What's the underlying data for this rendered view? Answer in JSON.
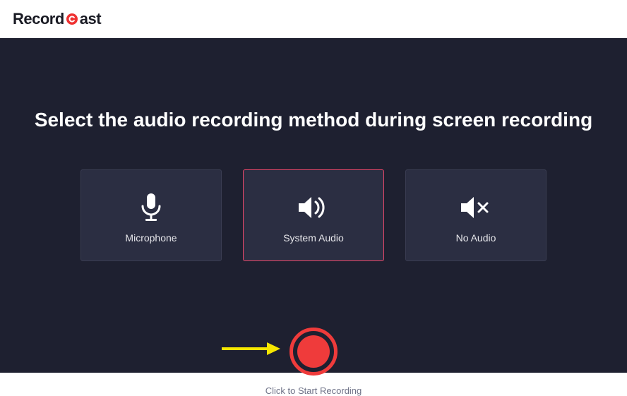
{
  "brand": {
    "pre": "Record",
    "post": "ast"
  },
  "title": "Select the audio recording method during screen recording",
  "options": {
    "microphone": "Microphone",
    "system_audio": "System Audio",
    "no_audio": "No Audio",
    "selected": "system_audio"
  },
  "record": {
    "caption": "Click to Start Recording"
  },
  "colors": {
    "accent": "#ef3b3b",
    "select_border": "#e8486a",
    "bg": "#1e2030",
    "card": "#2b2e42"
  }
}
